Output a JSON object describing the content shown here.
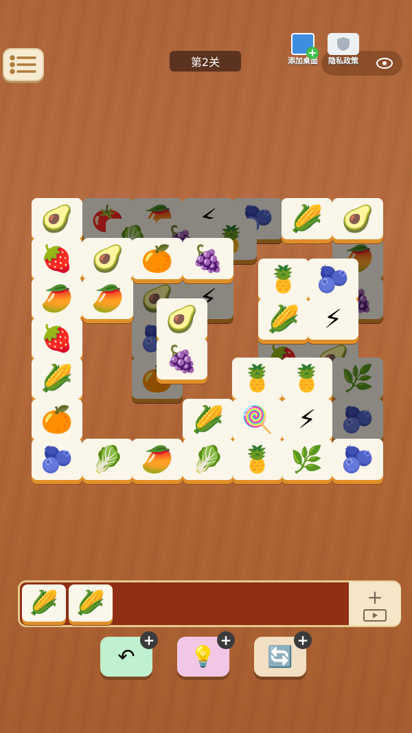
{
  "level": {
    "title": "第2关"
  },
  "top_right": {
    "add_desktop_label": "添加桌面",
    "privacy_label": "隐私政策"
  },
  "icons": {
    "avocado": "🥑",
    "tomato": "🍅",
    "lightning": "⚡",
    "blueberry": "🫐",
    "corn": "🌽",
    "strawberry": "🍓",
    "grape": "🍇",
    "pineapple": "🍍",
    "papaya": "🥭",
    "lettuce": "🥬",
    "candy": "🍭",
    "herb": "🌿",
    "orange": "🍊"
  },
  "board_tiles": [
    {
      "icon": "avocado",
      "dim": false
    },
    {
      "icon": "tomato",
      "dim": true
    },
    {
      "icon": "papaya",
      "dim": true
    },
    {
      "icon": "lightning",
      "dim": true
    },
    {
      "icon": "blueberry",
      "dim": true
    },
    {
      "icon": "corn",
      "dim": false
    },
    {
      "icon": "avocado",
      "dim": false
    },
    {
      "icon": "lettuce",
      "dim": true
    },
    {
      "icon": "grape",
      "dim": true
    },
    {
      "icon": "pineapple",
      "dim": true
    },
    {
      "icon": "strawberry",
      "dim": false
    },
    {
      "icon": "avocado",
      "dim": false
    },
    {
      "icon": "orange",
      "dim": false
    },
    {
      "icon": "grape",
      "dim": false
    },
    {
      "icon": "papaya",
      "dim": true
    },
    {
      "icon": "pineapple",
      "dim": false
    },
    {
      "icon": "blueberry",
      "dim": false
    },
    {
      "icon": "papaya",
      "dim": false
    },
    {
      "icon": "papaya",
      "dim": false
    },
    {
      "icon": "avocado",
      "dim": true
    },
    {
      "icon": "lightning",
      "dim": true
    },
    {
      "icon": "grape",
      "dim": true
    },
    {
      "icon": "corn",
      "dim": false
    },
    {
      "icon": "lightning",
      "dim": false
    },
    {
      "icon": "avocado",
      "dim": false
    },
    {
      "icon": "strawberry",
      "dim": false
    },
    {
      "icon": "blueberry",
      "dim": true
    },
    {
      "icon": "grape",
      "dim": false
    },
    {
      "icon": "strawberry",
      "dim": true
    },
    {
      "icon": "avocado",
      "dim": true
    },
    {
      "icon": "corn",
      "dim": false
    },
    {
      "icon": "orange",
      "dim": true
    },
    {
      "icon": "pineapple",
      "dim": false
    },
    {
      "icon": "pineapple",
      "dim": false
    },
    {
      "icon": "herb",
      "dim": true
    },
    {
      "icon": "orange",
      "dim": false
    },
    {
      "icon": "corn",
      "dim": false
    },
    {
      "icon": "candy",
      "dim": false
    },
    {
      "icon": "lightning",
      "dim": false
    },
    {
      "icon": "blueberry",
      "dim": true
    },
    {
      "icon": "blueberry",
      "dim": false
    },
    {
      "icon": "lettuce",
      "dim": false
    },
    {
      "icon": "papaya",
      "dim": false
    },
    {
      "icon": "lettuce",
      "dim": false
    },
    {
      "icon": "pineapple",
      "dim": false
    },
    {
      "icon": "herb",
      "dim": false
    },
    {
      "icon": "blueberry",
      "dim": false
    }
  ],
  "tray": {
    "tiles": [
      "corn",
      "corn"
    ],
    "add_slot_icon": "+",
    "video_icon": "video-icon"
  },
  "tools": [
    {
      "name": "undo",
      "icon": "↶",
      "color": "#bff0cf",
      "plus": "+"
    },
    {
      "name": "hint",
      "icon": "💡",
      "color": "#f2c7e6",
      "plus": "+"
    },
    {
      "name": "shuffle",
      "icon": "🔄",
      "color": "#f3dfc4",
      "plus": "+"
    }
  ]
}
